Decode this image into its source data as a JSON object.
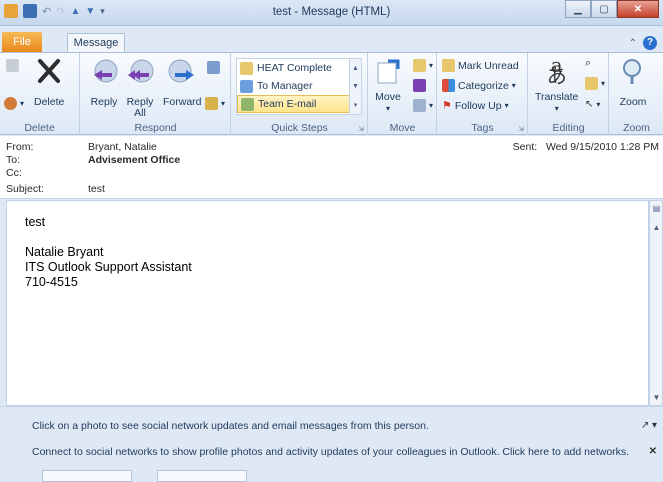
{
  "window": {
    "title": "test - Message (HTML)"
  },
  "tabs": {
    "file": "File",
    "message": "Message"
  },
  "ribbon": {
    "delete_group": {
      "label": "Delete",
      "delete_btn": "Delete"
    },
    "respond_group": {
      "label": "Respond",
      "reply": "Reply",
      "reply_all_line1": "Reply",
      "reply_all_line2": "All",
      "forward": "Forward"
    },
    "quick_steps": {
      "label": "Quick Steps",
      "items": [
        "HEAT Complete",
        "To Manager",
        "Team E-mail"
      ]
    },
    "move_group": {
      "label": "Move",
      "move_btn": "Move"
    },
    "tags_group": {
      "label": "Tags",
      "mark_unread": "Mark Unread",
      "categorize": "Categorize",
      "follow_up": "Follow Up"
    },
    "editing_group": {
      "label": "Editing",
      "translate": "Translate"
    },
    "zoom_group": {
      "label": "Zoom",
      "zoom_btn": "Zoom"
    }
  },
  "header": {
    "from_label": "From:",
    "from_value": "Bryant, Natalie",
    "to_label": "To:",
    "to_value": "Advisement Office",
    "cc_label": "Cc:",
    "subject_label": "Subject:",
    "subject_value": "test",
    "sent_label": "Sent:",
    "sent_value": "Wed 9/15/2010 1:28 PM"
  },
  "body": {
    "line1": "test",
    "sig_name": "Natalie Bryant",
    "sig_title": "ITS Outlook Support Assistant",
    "sig_phone": "710-4515"
  },
  "social": {
    "line1": "Click on a photo to see social network updates and email messages from this person.",
    "line2": "Connect to social networks to show profile photos and activity updates of your colleagues in Outlook. Click here to add networks."
  }
}
